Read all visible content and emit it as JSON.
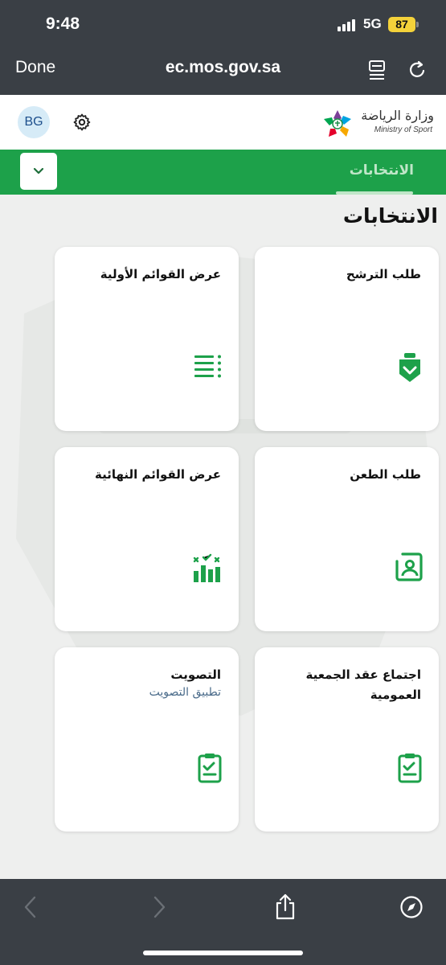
{
  "status_bar": {
    "time": "9:48",
    "network": "5G",
    "battery": "87"
  },
  "browser": {
    "done_label": "Done",
    "url": "ec.mos.gov.sa"
  },
  "header": {
    "avatar_initials": "BG",
    "logo_arabic": "وزارة الرياضة",
    "logo_english": "Ministry of Sport"
  },
  "nav": {
    "active_tab": "الانتخابات"
  },
  "page": {
    "title": "الانتخابات"
  },
  "cards": [
    {
      "title": "طلب الترشح",
      "icon": "shield-heart-icon"
    },
    {
      "title": "عرض القوائم الأولية",
      "icon": "list-icon"
    },
    {
      "title": "طلب الطعن",
      "icon": "appeal-person-icon"
    },
    {
      "title": "عرض القوائم النهائية",
      "icon": "results-chart-icon"
    },
    {
      "title": "اجتماع عقد الجمعية العمومية",
      "icon": "clipboard-check-icon"
    },
    {
      "title": "التصويت",
      "subtitle": "تطبيق التصويت",
      "icon": "clipboard-check-icon"
    }
  ],
  "colors": {
    "brand_green": "#1da14a",
    "chrome": "#3a3f45",
    "accent_blue": "#4a6b8a"
  }
}
